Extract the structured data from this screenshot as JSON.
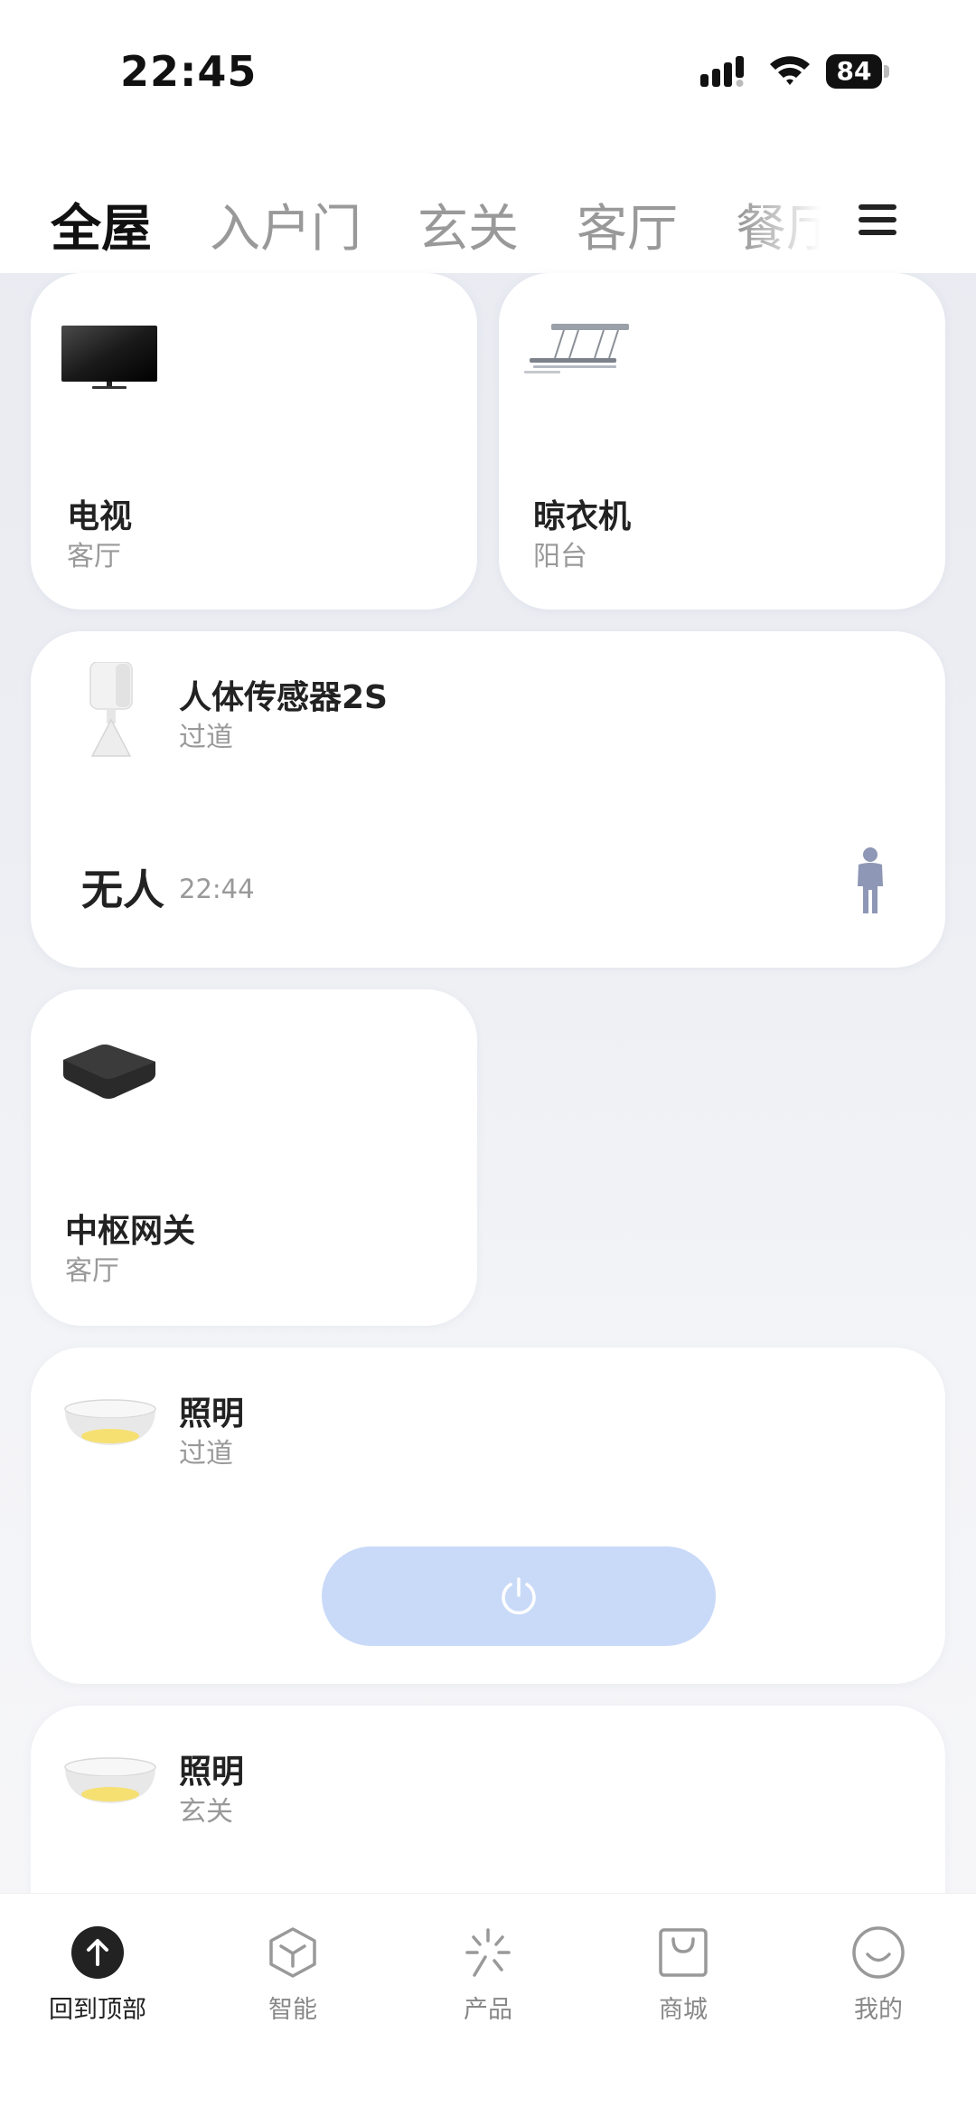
{
  "status_bar": {
    "time": "22:45",
    "battery": "84"
  },
  "tabs": [
    {
      "label": "全屋",
      "active": true
    },
    {
      "label": "入户门"
    },
    {
      "label": "玄关"
    },
    {
      "label": "客厅"
    },
    {
      "label": "餐厅"
    }
  ],
  "devices": {
    "tv": {
      "name": "电视",
      "room": "客厅"
    },
    "drying_rack": {
      "name": "晾衣机",
      "room": "阳台"
    },
    "motion_sensor": {
      "name": "人体传感器2S",
      "room": "过道",
      "state": "无人",
      "time": "22:44"
    },
    "hub": {
      "name": "中枢网关",
      "room": "客厅"
    },
    "light_1": {
      "name": "照明",
      "room": "过道"
    },
    "light_2": {
      "name": "照明",
      "room": "玄关"
    }
  },
  "bottom_nav": [
    {
      "label": "回到顶部",
      "icon": "arrow-up-icon",
      "active": true
    },
    {
      "label": "智能",
      "icon": "cube-icon"
    },
    {
      "label": "产品",
      "icon": "sparkle-icon"
    },
    {
      "label": "商城",
      "icon": "shopping-bag-icon"
    },
    {
      "label": "我的",
      "icon": "smile-icon"
    }
  ],
  "colors": {
    "accent_power": "#c9daf8",
    "sensor_figure": "#8e97b5"
  }
}
